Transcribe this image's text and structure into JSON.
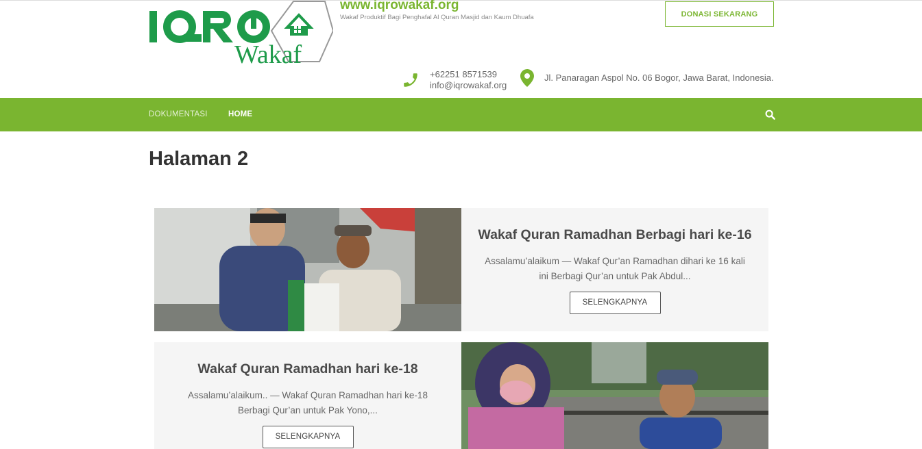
{
  "header": {
    "logo_alt": "IQRO Wakaf",
    "site_url": "www.iqrowakaf.org",
    "tagline": "Wakaf Produktif Bagi Penghafal Al Quran Masjid dan Kaum Dhuafa",
    "donate_label": "DONASI SEKARANG",
    "phone": "+62251 8571539",
    "email": "info@iqrowakaf.org",
    "address": "Jl. Panaragan Aspol No. 06 Bogor, Jawa Barat, Indonesia."
  },
  "nav": {
    "items": [
      {
        "label": "DOKUMENTASI"
      },
      {
        "label": "HOME"
      }
    ],
    "search_icon": "search-icon"
  },
  "page": {
    "title": "Halaman 2"
  },
  "posts": [
    {
      "title": "Wakaf Quran Ramadhan Berbagi hari ke-16",
      "excerpt": "Assalamu’alaikum — Wakaf Qur’an Ramadhan dihari ke 16 kali ini Berbagi Qur’an untuk Pak Abdul...",
      "button": "SELENGKAPNYA"
    },
    {
      "title": "Wakaf Quran Ramadhan hari ke-18",
      "excerpt": "Assalamu’alaikum.. — Wakaf Quran Ramadhan hari ke-18 Berbagi Qur’an untuk Pak Yono,...",
      "button": "SELENGKAPNYA"
    }
  ],
  "colors": {
    "brand_green": "#7ab530",
    "logo_green": "#1e9b4a",
    "card_bg": "#f5f5f5"
  }
}
